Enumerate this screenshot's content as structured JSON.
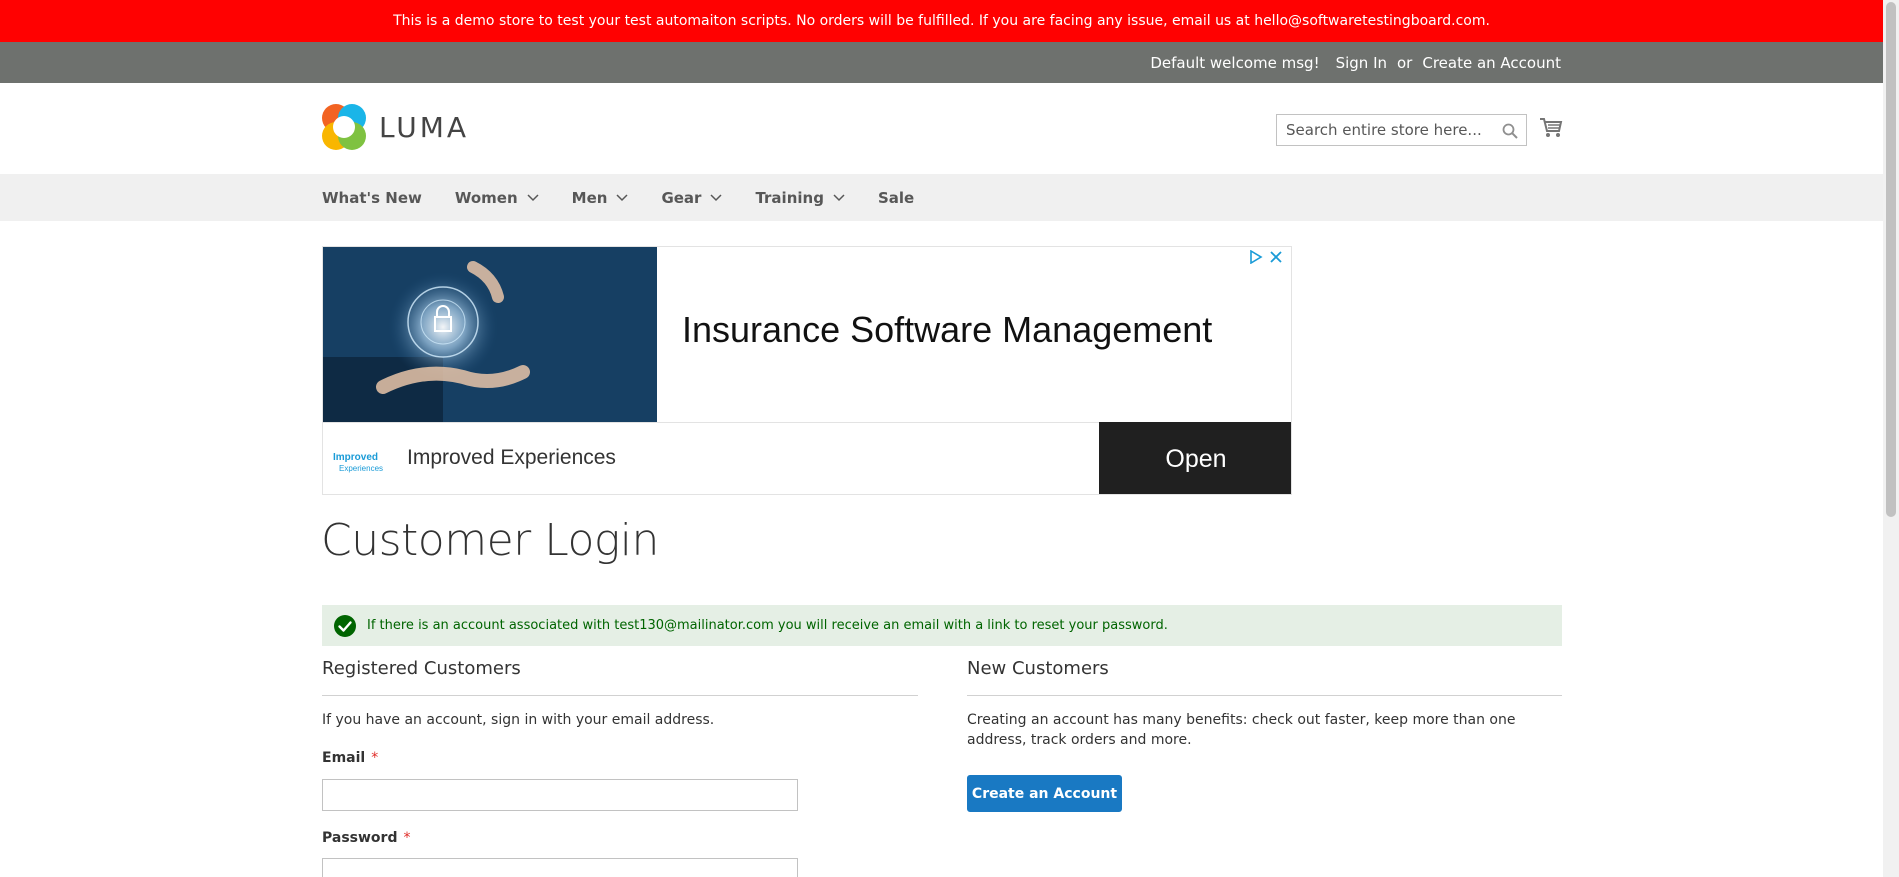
{
  "demo_notice": "This is a demo store to test your test automaiton scripts. No orders will be fulfilled. If you are facing any issue, email us at hello@softwaretestingboard.com.",
  "header": {
    "welcome": "Default welcome msg!",
    "sign_in": "Sign In",
    "or": "or",
    "create_account": "Create an Account"
  },
  "logo": {
    "text": "LUMA",
    "icon": "luma-logo-icon"
  },
  "search": {
    "placeholder": "Search entire store here...",
    "value": "",
    "icon": "search-icon"
  },
  "cart": {
    "icon": "cart-icon"
  },
  "nav": {
    "items": [
      {
        "label": "What's New",
        "has_dropdown": false
      },
      {
        "label": "Women",
        "has_dropdown": true
      },
      {
        "label": "Men",
        "has_dropdown": true
      },
      {
        "label": "Gear",
        "has_dropdown": true
      },
      {
        "label": "Training",
        "has_dropdown": true
      },
      {
        "label": "Sale",
        "has_dropdown": false
      }
    ]
  },
  "ad": {
    "headline": "Insurance Software Management",
    "brand_name": "Improved Experiences",
    "brand_logo_text": "Improved Experiences",
    "cta": "Open",
    "icons": [
      "adchoices-icon",
      "close-icon"
    ]
  },
  "page": {
    "title": "Customer Login"
  },
  "message": {
    "type": "success",
    "text": "If there is an account associated with test130@mailinator.com you will receive an email with a link to reset your password.",
    "icon": "check-circle-icon"
  },
  "registered": {
    "title": "Registered Customers",
    "intro": "If you have an account, sign in with your email address.",
    "email_label": "Email",
    "email_value": "",
    "password_label": "Password",
    "password_value": "",
    "required_mark": "*"
  },
  "new_customers": {
    "title": "New Customers",
    "text": "Creating an account has many benefits: check out faster, keep more than one address, track orders and more.",
    "button": "Create an Account"
  },
  "colors": {
    "demo_notice_bg": "#ff0101",
    "header_bar_bg": "#6e716e",
    "nav_bg": "#f0f0f0",
    "message_bg": "#e5efe5",
    "message_text": "#006400",
    "primary_button": "#1979c3",
    "required": "#e02b27"
  }
}
